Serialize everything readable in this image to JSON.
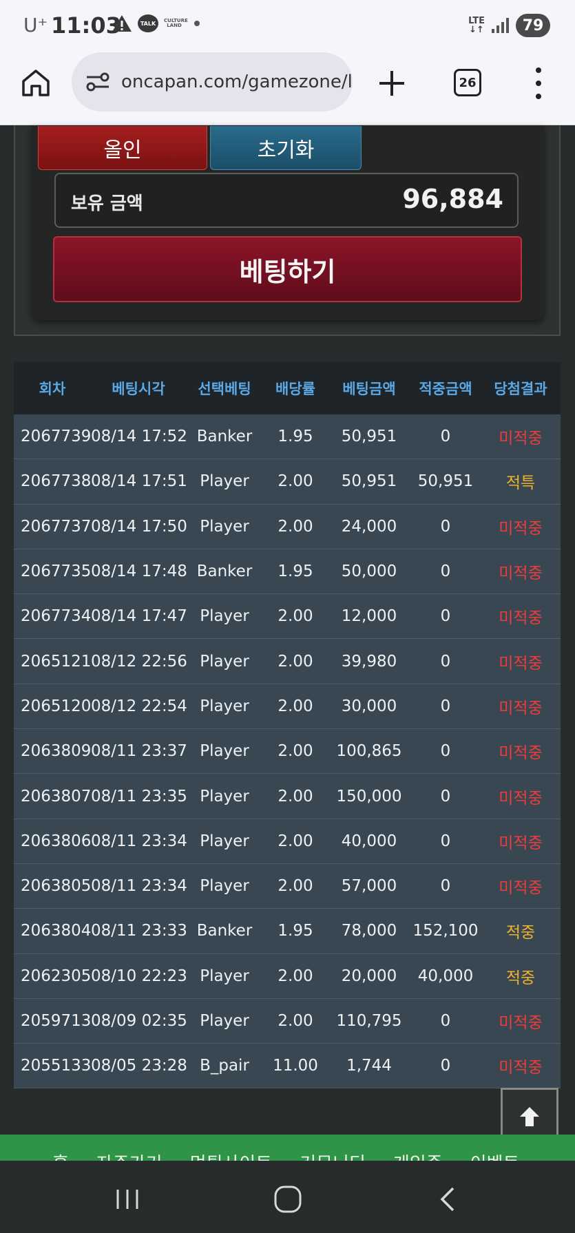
{
  "status_bar": {
    "carrier": "U⁺",
    "time": "11:03",
    "talk_icon_text": "TALK",
    "culture_icon_text": "CULTURE LAND",
    "network": "LTE",
    "battery": "79"
  },
  "browser": {
    "url": "oncapan.com/gamezone/l",
    "tab_count": "26"
  },
  "bet_panel": {
    "allin_label": "올인",
    "reset_label": "초기화",
    "balance_label": "보유 금액",
    "balance_value": "96,884",
    "bet_button_label": "베팅하기"
  },
  "history": {
    "headers": [
      "회차",
      "베팅시각",
      "선택베팅",
      "배당률",
      "베팅금액",
      "적중금액",
      "당첨결과"
    ],
    "rows": [
      {
        "round": "2067739",
        "time": "08/14 17:52",
        "choice": "Banker",
        "odds": "1.95",
        "bet": "50,951",
        "win": "0",
        "result": "미적중",
        "status": "lose"
      },
      {
        "round": "2067738",
        "time": "08/14 17:51",
        "choice": "Player",
        "odds": "2.00",
        "bet": "50,951",
        "win": "50,951",
        "result": "적특",
        "status": "win"
      },
      {
        "round": "2067737",
        "time": "08/14 17:50",
        "choice": "Player",
        "odds": "2.00",
        "bet": "24,000",
        "win": "0",
        "result": "미적중",
        "status": "lose"
      },
      {
        "round": "2067735",
        "time": "08/14 17:48",
        "choice": "Banker",
        "odds": "1.95",
        "bet": "50,000",
        "win": "0",
        "result": "미적중",
        "status": "lose"
      },
      {
        "round": "2067734",
        "time": "08/14 17:47",
        "choice": "Player",
        "odds": "2.00",
        "bet": "12,000",
        "win": "0",
        "result": "미적중",
        "status": "lose"
      },
      {
        "round": "2065121",
        "time": "08/12 22:56",
        "choice": "Player",
        "odds": "2.00",
        "bet": "39,980",
        "win": "0",
        "result": "미적중",
        "status": "lose"
      },
      {
        "round": "2065120",
        "time": "08/12 22:54",
        "choice": "Player",
        "odds": "2.00",
        "bet": "30,000",
        "win": "0",
        "result": "미적중",
        "status": "lose"
      },
      {
        "round": "2063809",
        "time": "08/11 23:37",
        "choice": "Player",
        "odds": "2.00",
        "bet": "100,865",
        "win": "0",
        "result": "미적중",
        "status": "lose"
      },
      {
        "round": "2063807",
        "time": "08/11 23:35",
        "choice": "Player",
        "odds": "2.00",
        "bet": "150,000",
        "win": "0",
        "result": "미적중",
        "status": "lose"
      },
      {
        "round": "2063806",
        "time": "08/11 23:34",
        "choice": "Player",
        "odds": "2.00",
        "bet": "40,000",
        "win": "0",
        "result": "미적중",
        "status": "lose"
      },
      {
        "round": "2063805",
        "time": "08/11 23:34",
        "choice": "Player",
        "odds": "2.00",
        "bet": "57,000",
        "win": "0",
        "result": "미적중",
        "status": "lose"
      },
      {
        "round": "2063804",
        "time": "08/11 23:33",
        "choice": "Banker",
        "odds": "1.95",
        "bet": "78,000",
        "win": "152,100",
        "result": "적중",
        "status": "win"
      },
      {
        "round": "2062305",
        "time": "08/10 22:23",
        "choice": "Player",
        "odds": "2.00",
        "bet": "20,000",
        "win": "40,000",
        "result": "적중",
        "status": "win"
      },
      {
        "round": "2059713",
        "time": "08/09 02:35",
        "choice": "Player",
        "odds": "2.00",
        "bet": "110,795",
        "win": "0",
        "result": "미적중",
        "status": "lose"
      },
      {
        "round": "2055133",
        "time": "08/05 23:28",
        "choice": "B_pair",
        "odds": "11.00",
        "bet": "1,744",
        "win": "0",
        "result": "미적중",
        "status": "lose"
      }
    ]
  },
  "footer": {
    "links": [
      "홈",
      "자주가기",
      "먹튀사이트",
      "커뮤니티",
      "게임존",
      "이벤트"
    ]
  },
  "colors": {
    "lose": "#ee3b3b",
    "win": "#f0b030",
    "header_text": "#5aa8e6",
    "row_bg": "#384752",
    "footer_green": "#2f9447"
  },
  "icons": {
    "browser_home": "home-icon",
    "site_settings": "tune-icon",
    "new_tab": "plus-icon",
    "tab_switcher": "tabs-icon",
    "overflow_menu": "more-vert-icon",
    "scroll_top": "arrow-up-icon",
    "nav_recents": "recents-icon",
    "nav_home": "home-circle-icon",
    "nav_back": "back-icon"
  }
}
